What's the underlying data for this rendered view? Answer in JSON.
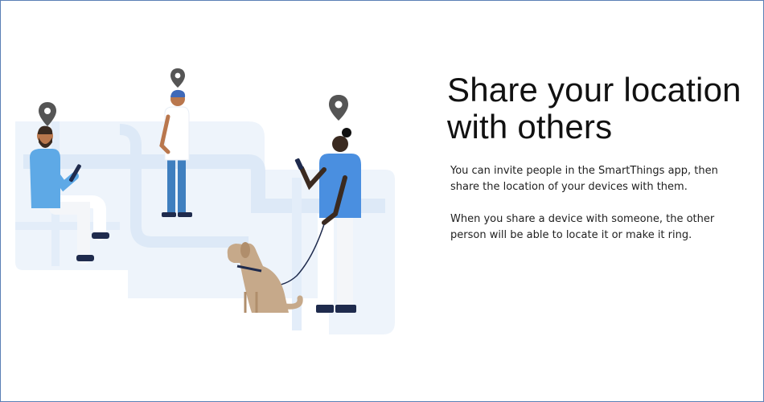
{
  "heading": "Share your location with others",
  "paragraphs": [
    "You can invite people in the SmartThings app, then share the location of your devices with them.",
    "When you share a device with someone, the other person will be able to locate it or make it ring."
  ],
  "illustration": {
    "description_icons": [
      "location-pin-icon",
      "location-pin-icon",
      "location-pin-icon"
    ],
    "colors": {
      "map": "#eaf2fb",
      "map_road": "#dce9f8",
      "pin": "#555555",
      "shirt_blue": "#4a8fe0",
      "shirt_light": "#5ea9e6",
      "pants_blue": "#3f7fbf",
      "dog": "#c6a98a",
      "skin_dark": "#3a2a20",
      "skin_tan": "#b9774d",
      "navy": "#1f2b4d"
    }
  }
}
